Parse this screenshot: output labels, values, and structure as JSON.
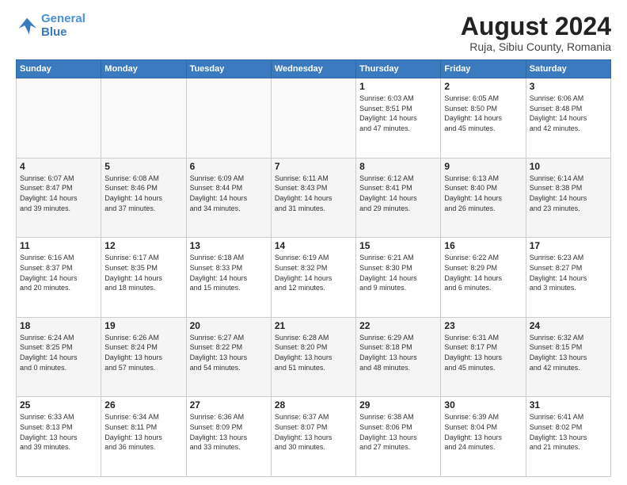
{
  "header": {
    "logo_line1": "General",
    "logo_line2": "Blue",
    "title": "August 2024",
    "subtitle": "Ruja, Sibiu County, Romania"
  },
  "calendar": {
    "days_of_week": [
      "Sunday",
      "Monday",
      "Tuesday",
      "Wednesday",
      "Thursday",
      "Friday",
      "Saturday"
    ],
    "weeks": [
      [
        {
          "day": "",
          "info": "",
          "empty": true
        },
        {
          "day": "",
          "info": "",
          "empty": true
        },
        {
          "day": "",
          "info": "",
          "empty": true
        },
        {
          "day": "",
          "info": "",
          "empty": true
        },
        {
          "day": "1",
          "info": "Sunrise: 6:03 AM\nSunset: 8:51 PM\nDaylight: 14 hours\nand 47 minutes."
        },
        {
          "day": "2",
          "info": "Sunrise: 6:05 AM\nSunset: 8:50 PM\nDaylight: 14 hours\nand 45 minutes."
        },
        {
          "day": "3",
          "info": "Sunrise: 6:06 AM\nSunset: 8:48 PM\nDaylight: 14 hours\nand 42 minutes."
        }
      ],
      [
        {
          "day": "4",
          "info": "Sunrise: 6:07 AM\nSunset: 8:47 PM\nDaylight: 14 hours\nand 39 minutes."
        },
        {
          "day": "5",
          "info": "Sunrise: 6:08 AM\nSunset: 8:46 PM\nDaylight: 14 hours\nand 37 minutes."
        },
        {
          "day": "6",
          "info": "Sunrise: 6:09 AM\nSunset: 8:44 PM\nDaylight: 14 hours\nand 34 minutes."
        },
        {
          "day": "7",
          "info": "Sunrise: 6:11 AM\nSunset: 8:43 PM\nDaylight: 14 hours\nand 31 minutes."
        },
        {
          "day": "8",
          "info": "Sunrise: 6:12 AM\nSunset: 8:41 PM\nDaylight: 14 hours\nand 29 minutes."
        },
        {
          "day": "9",
          "info": "Sunrise: 6:13 AM\nSunset: 8:40 PM\nDaylight: 14 hours\nand 26 minutes."
        },
        {
          "day": "10",
          "info": "Sunrise: 6:14 AM\nSunset: 8:38 PM\nDaylight: 14 hours\nand 23 minutes."
        }
      ],
      [
        {
          "day": "11",
          "info": "Sunrise: 6:16 AM\nSunset: 8:37 PM\nDaylight: 14 hours\nand 20 minutes."
        },
        {
          "day": "12",
          "info": "Sunrise: 6:17 AM\nSunset: 8:35 PM\nDaylight: 14 hours\nand 18 minutes."
        },
        {
          "day": "13",
          "info": "Sunrise: 6:18 AM\nSunset: 8:33 PM\nDaylight: 14 hours\nand 15 minutes."
        },
        {
          "day": "14",
          "info": "Sunrise: 6:19 AM\nSunset: 8:32 PM\nDaylight: 14 hours\nand 12 minutes."
        },
        {
          "day": "15",
          "info": "Sunrise: 6:21 AM\nSunset: 8:30 PM\nDaylight: 14 hours\nand 9 minutes."
        },
        {
          "day": "16",
          "info": "Sunrise: 6:22 AM\nSunset: 8:29 PM\nDaylight: 14 hours\nand 6 minutes."
        },
        {
          "day": "17",
          "info": "Sunrise: 6:23 AM\nSunset: 8:27 PM\nDaylight: 14 hours\nand 3 minutes."
        }
      ],
      [
        {
          "day": "18",
          "info": "Sunrise: 6:24 AM\nSunset: 8:25 PM\nDaylight: 14 hours\nand 0 minutes."
        },
        {
          "day": "19",
          "info": "Sunrise: 6:26 AM\nSunset: 8:24 PM\nDaylight: 13 hours\nand 57 minutes."
        },
        {
          "day": "20",
          "info": "Sunrise: 6:27 AM\nSunset: 8:22 PM\nDaylight: 13 hours\nand 54 minutes."
        },
        {
          "day": "21",
          "info": "Sunrise: 6:28 AM\nSunset: 8:20 PM\nDaylight: 13 hours\nand 51 minutes."
        },
        {
          "day": "22",
          "info": "Sunrise: 6:29 AM\nSunset: 8:18 PM\nDaylight: 13 hours\nand 48 minutes."
        },
        {
          "day": "23",
          "info": "Sunrise: 6:31 AM\nSunset: 8:17 PM\nDaylight: 13 hours\nand 45 minutes."
        },
        {
          "day": "24",
          "info": "Sunrise: 6:32 AM\nSunset: 8:15 PM\nDaylight: 13 hours\nand 42 minutes."
        }
      ],
      [
        {
          "day": "25",
          "info": "Sunrise: 6:33 AM\nSunset: 8:13 PM\nDaylight: 13 hours\nand 39 minutes."
        },
        {
          "day": "26",
          "info": "Sunrise: 6:34 AM\nSunset: 8:11 PM\nDaylight: 13 hours\nand 36 minutes."
        },
        {
          "day": "27",
          "info": "Sunrise: 6:36 AM\nSunset: 8:09 PM\nDaylight: 13 hours\nand 33 minutes."
        },
        {
          "day": "28",
          "info": "Sunrise: 6:37 AM\nSunset: 8:07 PM\nDaylight: 13 hours\nand 30 minutes."
        },
        {
          "day": "29",
          "info": "Sunrise: 6:38 AM\nSunset: 8:06 PM\nDaylight: 13 hours\nand 27 minutes."
        },
        {
          "day": "30",
          "info": "Sunrise: 6:39 AM\nSunset: 8:04 PM\nDaylight: 13 hours\nand 24 minutes."
        },
        {
          "day": "31",
          "info": "Sunrise: 6:41 AM\nSunset: 8:02 PM\nDaylight: 13 hours\nand 21 minutes."
        }
      ]
    ]
  }
}
